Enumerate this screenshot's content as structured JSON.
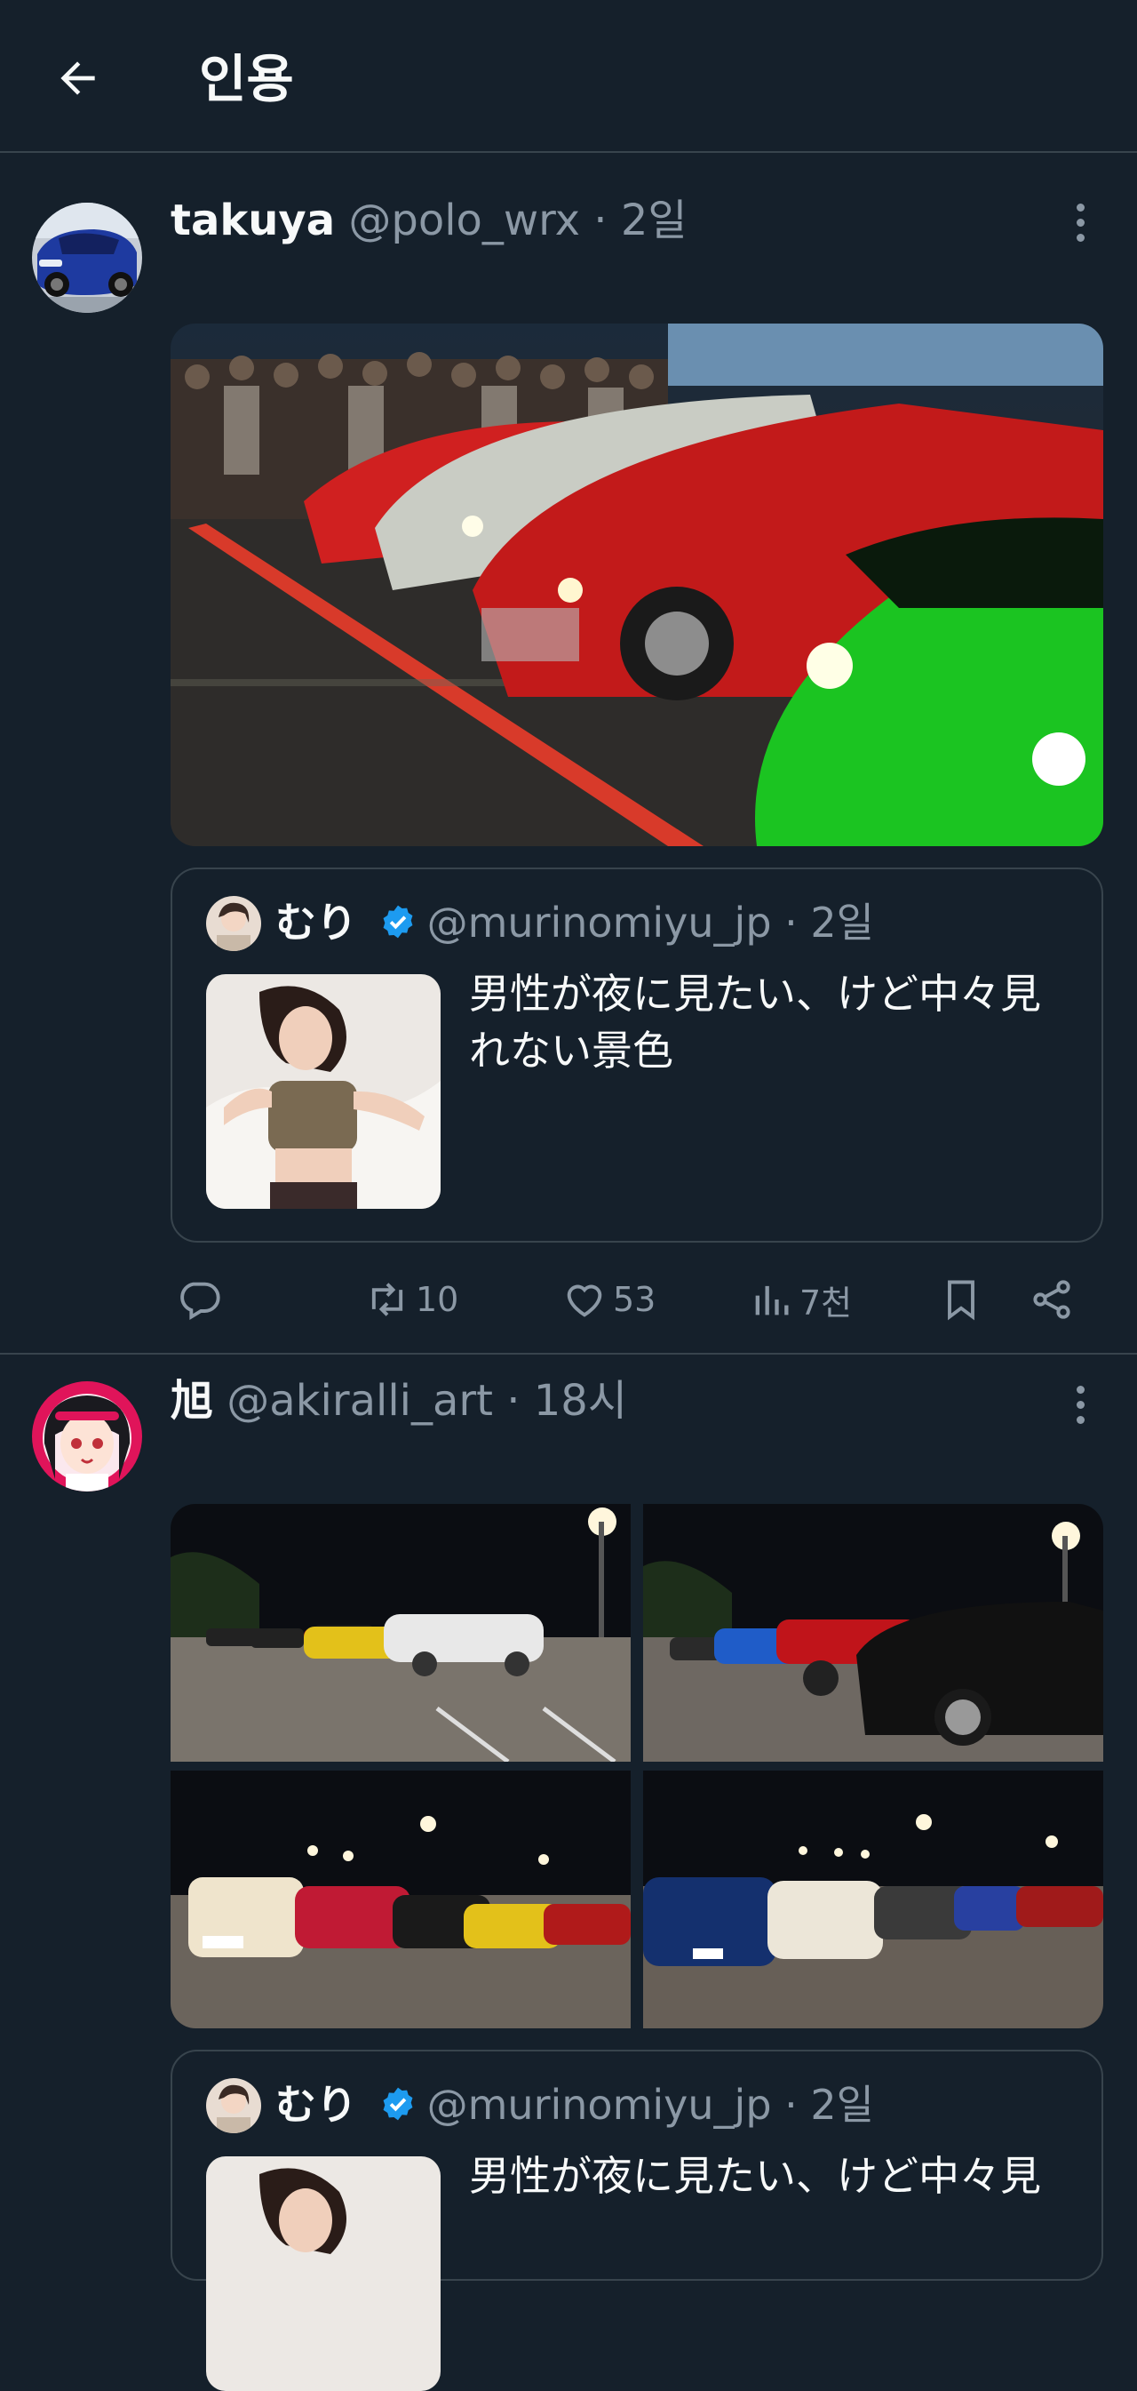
{
  "header": {
    "title": "인용"
  },
  "posts": [
    {
      "name": "takuya",
      "handle": "@polo_wrx",
      "time": "2일",
      "quote": {
        "name": "むり",
        "handle": "@murinomiyu_jp",
        "time": "2일",
        "text": "男性が夜に見たい、けど中々見れない景色"
      },
      "actions": {
        "retweets": "10",
        "likes": "53",
        "views": "7천"
      }
    },
    {
      "name": "旭",
      "handle": "@akiralli_art",
      "time": "18시",
      "quote": {
        "name": "むり",
        "handle": "@murinomiyu_jp",
        "time": "2일",
        "text": "男性が夜に見たい、けど中々見"
      }
    }
  ],
  "colors": {
    "background": "#15202b",
    "text": "#f7f9f9",
    "secondary": "#8b98a5",
    "border": "#38444d",
    "verified": "#1d9bf0"
  },
  "icons": [
    "arrow-left-icon",
    "more-vertical-icon",
    "verified-badge-icon",
    "reply-icon",
    "retweet-icon",
    "heart-icon",
    "views-icon",
    "bookmark-icon",
    "share-icon"
  ]
}
